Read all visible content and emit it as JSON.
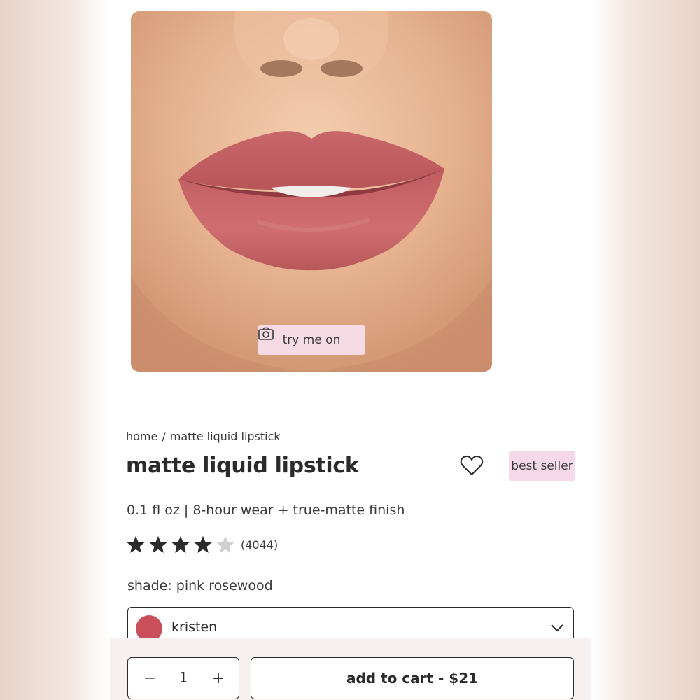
{
  "product_image": {
    "alt": "lips wearing matte liquid lipstick",
    "try_on_label": "try me on",
    "try_on_icon": "camera-icon"
  },
  "breadcrumb": {
    "home": "home",
    "separator": "/",
    "current": "matte liquid lipstick"
  },
  "product": {
    "title": "matte liquid lipstick",
    "badge": "best seller",
    "subtitle": "0.1 fl oz | 8-hour wear + true-matte finish",
    "rating": 4,
    "rating_max": 5,
    "review_count": "(4044)"
  },
  "shade": {
    "label": "shade: pink rosewood",
    "selected": "kristen",
    "swatch_color": "#c94f5a"
  },
  "cart": {
    "quantity": "1",
    "minus": "−",
    "plus": "+",
    "add_label": "add to cart - $21"
  },
  "colors": {
    "badge_bg": "#f5d9e8",
    "try_on_bg": "#f6dbe4",
    "star_filled": "#2b2b2b",
    "star_empty": "#cfcfcf"
  }
}
